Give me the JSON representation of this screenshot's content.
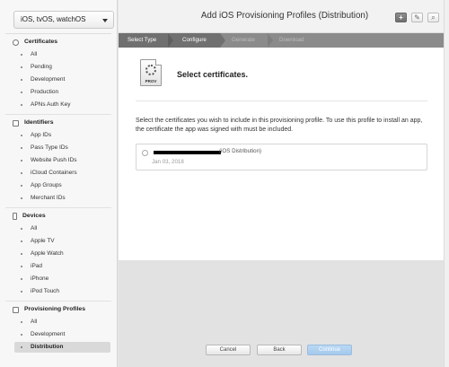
{
  "sidebar": {
    "platform": "iOS, tvOS, watchOS",
    "sections": [
      {
        "title": "Certificates",
        "icon": "certificate-icon",
        "items": [
          "All",
          "Pending",
          "Development",
          "Production",
          "APNs Auth Key"
        ]
      },
      {
        "title": "Identifiers",
        "icon": "id-icon",
        "items": [
          "App IDs",
          "Pass Type IDs",
          "Website Push IDs",
          "iCloud Containers",
          "App Groups",
          "Merchant IDs"
        ]
      },
      {
        "title": "Devices",
        "icon": "device-icon",
        "items": [
          "All",
          "Apple TV",
          "Apple Watch",
          "iPad",
          "iPhone",
          "iPod Touch"
        ]
      },
      {
        "title": "Provisioning Profiles",
        "icon": "profile-icon",
        "items": [
          "All",
          "Development",
          "Distribution"
        ]
      }
    ],
    "active_item": "Distribution"
  },
  "header": {
    "title": "Add iOS Provisioning Profiles (Distribution)",
    "add_symbol": "+",
    "edit_symbol": "✎",
    "search_symbol": "⌕"
  },
  "steps": [
    "Select Type",
    "Configure",
    "Generate",
    "Download"
  ],
  "content": {
    "icon_label": "PROV",
    "heading": "Select certificates.",
    "description": "Select the certificates you wish to include in this provisioning profile. To use this profile to install an app, the certificate the app was signed with must be included.",
    "certificate": {
      "name": "(iOS Distribution)",
      "date": "Jan 03, 2018"
    }
  },
  "footer": {
    "cancel": "Cancel",
    "back": "Back",
    "continue": "Continue"
  }
}
